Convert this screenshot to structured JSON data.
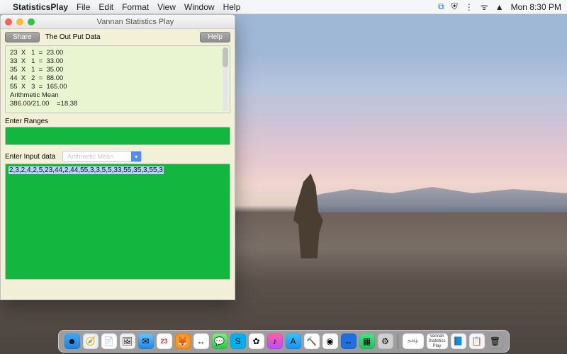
{
  "menubar": {
    "app_name": "StatisticsPlay",
    "items": [
      "File",
      "Edit",
      "Format",
      "View",
      "Window",
      "Help"
    ],
    "clock": "Mon 8:30 PM",
    "status_icons": [
      "teamviewer-icon",
      "shield-icon",
      "wifi-icon",
      "volume-icon",
      "spotlight-icon"
    ]
  },
  "window": {
    "title": "Vannan Statistics Play",
    "share_button": "Share",
    "output_label": "The Out Put Data",
    "help_button": "Help",
    "output_text": "23  X   1  =  23.00\n33  X   1  =  33.00\n35  X   1  =  35.00\n44  X   2  =  88.00\n55  X   3  =  165.00\nArithmetic Mean\n386.00/21.00    =18.38",
    "ranges_label": "Enter Ranges",
    "input_label": "Enter Input data",
    "method_select": {
      "placeholder": "Arithmetic Mean"
    },
    "input_data": "2,3,2,4,2,5,23,44,2,44,55,3,3,5,5,33,55,35,3,55,3"
  },
  "dock": {
    "items": [
      {
        "name": "finder-icon",
        "bg": "linear-gradient(#3ea9f5,#1f7fe0)",
        "glyph": "☻"
      },
      {
        "name": "safari-icon",
        "bg": "radial-gradient(#fff,#d8e6f4)",
        "glyph": "🧭"
      },
      {
        "name": "textedit-icon",
        "bg": "#fff",
        "glyph": "📄"
      },
      {
        "name": "preview-icon",
        "bg": "#f0f0f0",
        "glyph": "🖼"
      },
      {
        "name": "mail-icon",
        "bg": "linear-gradient(#6fc2ff,#1587e8)",
        "glyph": "✉"
      },
      {
        "name": "calendar-icon",
        "bg": "#fff",
        "glyph": "23"
      },
      {
        "name": "firefox-icon",
        "bg": "radial-gradient(#ffb84d,#ff7b00)",
        "glyph": "🦊"
      },
      {
        "name": "teamviewer-icon",
        "bg": "#fff",
        "glyph": "↔"
      },
      {
        "name": "messages-icon",
        "bg": "linear-gradient(#7ef07e,#23c943)",
        "glyph": "💬"
      },
      {
        "name": "skype-icon",
        "bg": "#00aff0",
        "glyph": "S"
      },
      {
        "name": "photos-icon",
        "bg": "#fff",
        "glyph": "✿"
      },
      {
        "name": "itunes-icon",
        "bg": "linear-gradient(#ff5fa2,#b44dff)",
        "glyph": "♪"
      },
      {
        "name": "appstore-icon",
        "bg": "linear-gradient(#36c3ff,#1a8ff0)",
        "glyph": "A"
      },
      {
        "name": "xcode-icon",
        "bg": "#fff",
        "glyph": "🔨"
      },
      {
        "name": "chrome-icon",
        "bg": "#fff",
        "glyph": "◉"
      },
      {
        "name": "teamviewer2-icon",
        "bg": "#1f6fe0",
        "glyph": "↔"
      },
      {
        "name": "numbers-icon",
        "bg": "linear-gradient(#4fe08a,#1fbf60)",
        "glyph": "▦"
      },
      {
        "name": "settings-icon",
        "bg": "#d0d0d0",
        "glyph": "⚙"
      }
    ],
    "right_items": [
      {
        "name": "tamil-label",
        "text": "தமிழ்"
      },
      {
        "name": "vannan-label",
        "text": "Vannan\nStatistics\nPlay"
      },
      {
        "name": "doc1-icon",
        "bg": "#f3f6f8",
        "glyph": "📘"
      },
      {
        "name": "doc2-icon",
        "bg": "#f3f6f8",
        "glyph": "📋"
      },
      {
        "name": "trash-icon",
        "bg": "transparent",
        "glyph": "🗑"
      }
    ]
  }
}
